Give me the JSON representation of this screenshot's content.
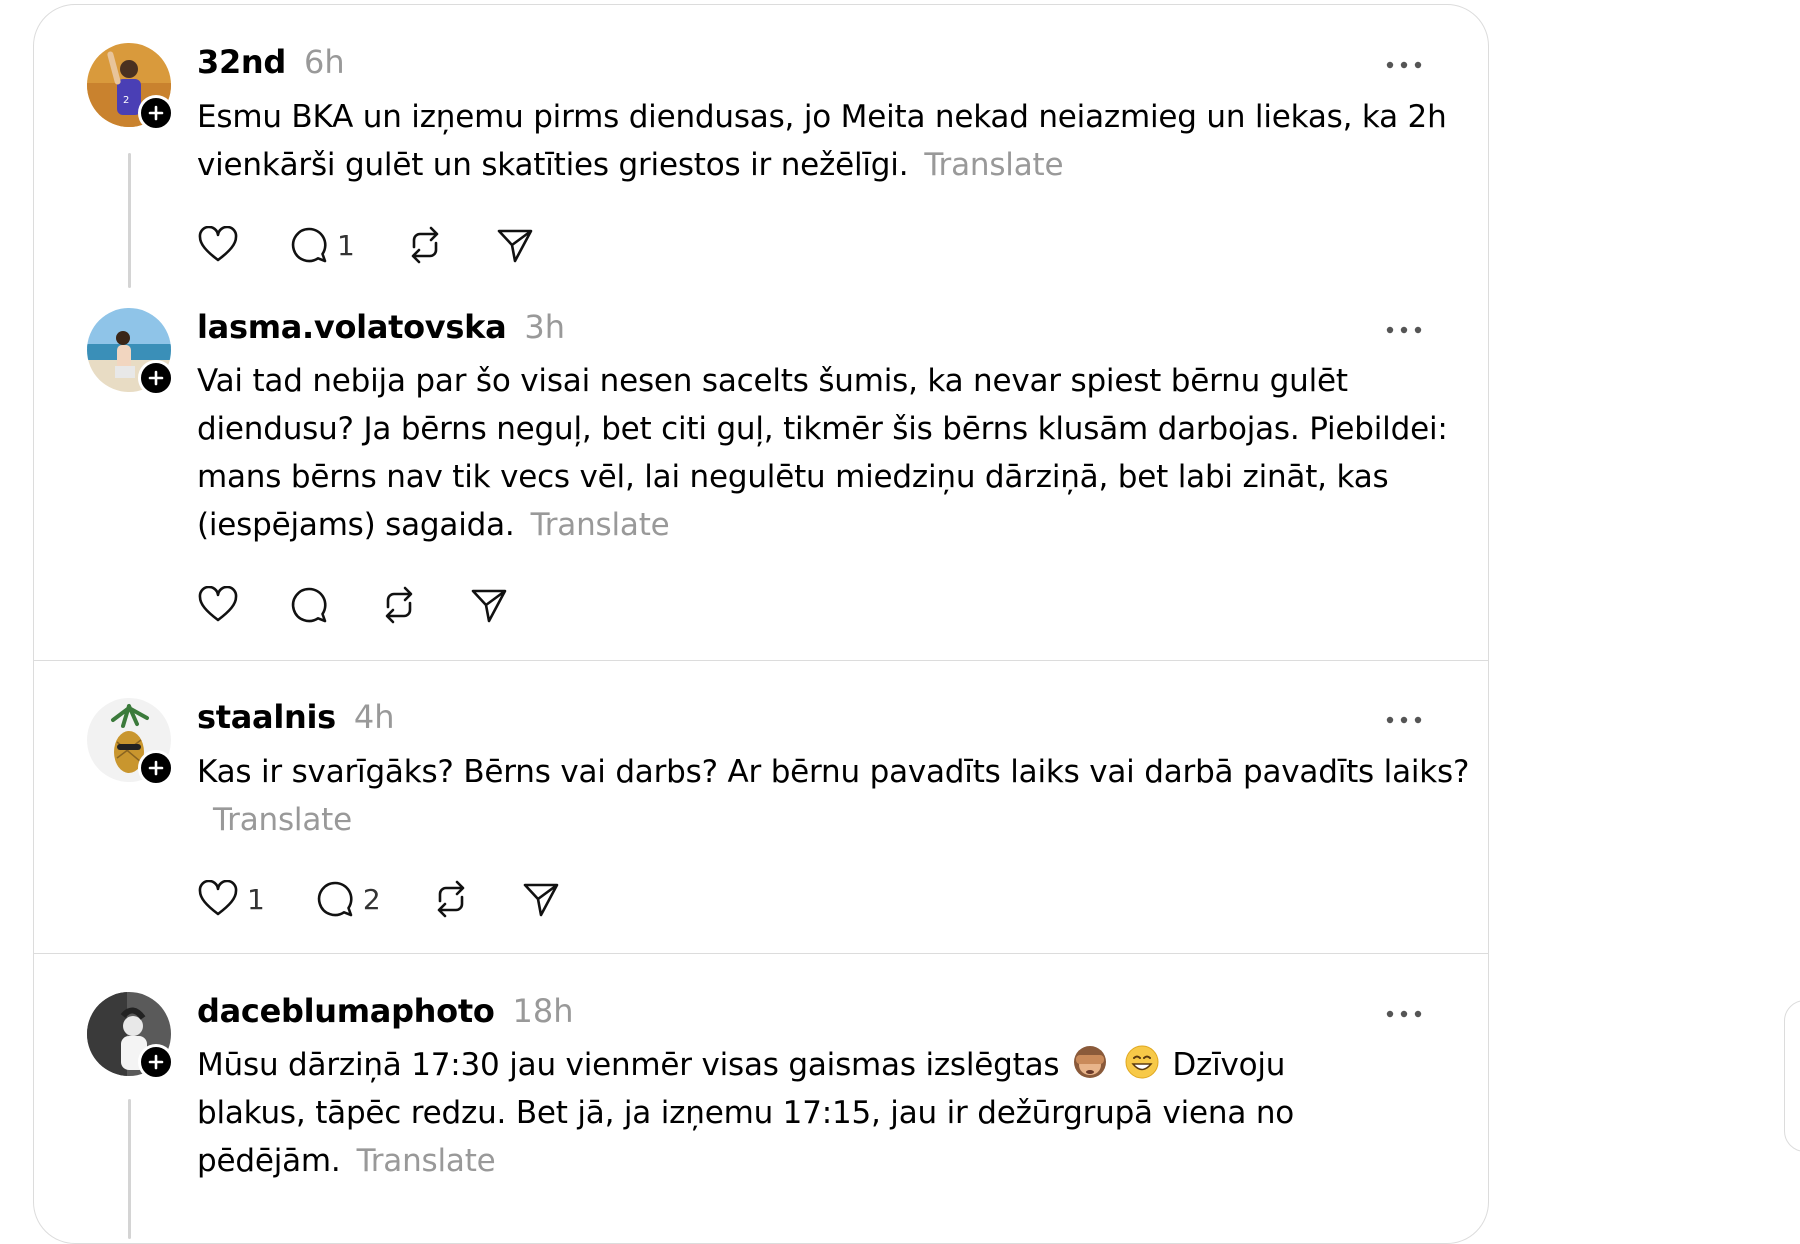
{
  "posts": [
    {
      "username": "32nd",
      "time": "6h",
      "text": "Esmu BKA un izņemu pirms diendusas, jo Meita nekad neiazmieg un liekas, ka 2h vienkārši gulēt un skatīties griestos ir nežēlīgi.",
      "translate": "Translate",
      "likes": "",
      "replies": "1"
    },
    {
      "username": "lasma.volatovska",
      "time": "3h",
      "text": "Vai tad nebija par šo visai nesen sacelts šumis, ka nevar spiest bērnu gulēt diendusu? Ja bērns neguļ, bet citi guļ, tikmēr šis bērns klusām darbojas. Piebildei: mans bērns nav tik vecs vēl, lai negulētu miedziņu dārziņā, bet labi zināt, kas (iespējams) sagaida.",
      "translate": "Translate",
      "likes": "",
      "replies": ""
    },
    {
      "username": "staalnis",
      "time": "4h",
      "text": "Kas ir svarīgāks? Bērns vai darbs? Ar bērnu pavadīts laiks vai darbā pavadīts laiks?",
      "translate": "Translate",
      "likes": "1",
      "replies": "2"
    },
    {
      "username": "daceblumaphoto",
      "time": "18h",
      "text_before_emoji": "Mūsu dārziņā 17:30 jau vienmēr visas gaismas izslēgtas",
      "emojis": [
        "see-no-evil-monkey",
        "grinning-face"
      ],
      "text_after_emoji": "Dzīvoju blakus, tāpēc redzu. Bet jā, ja izņemu 17:15, jau ir dežūrgrupā viena no pēdējām.",
      "translate": "Translate"
    }
  ],
  "icons": {
    "like": "heart-icon",
    "reply": "comment-icon",
    "repost": "repost-icon",
    "share": "send-icon",
    "more": "more-icon",
    "follow": "plus-icon"
  }
}
